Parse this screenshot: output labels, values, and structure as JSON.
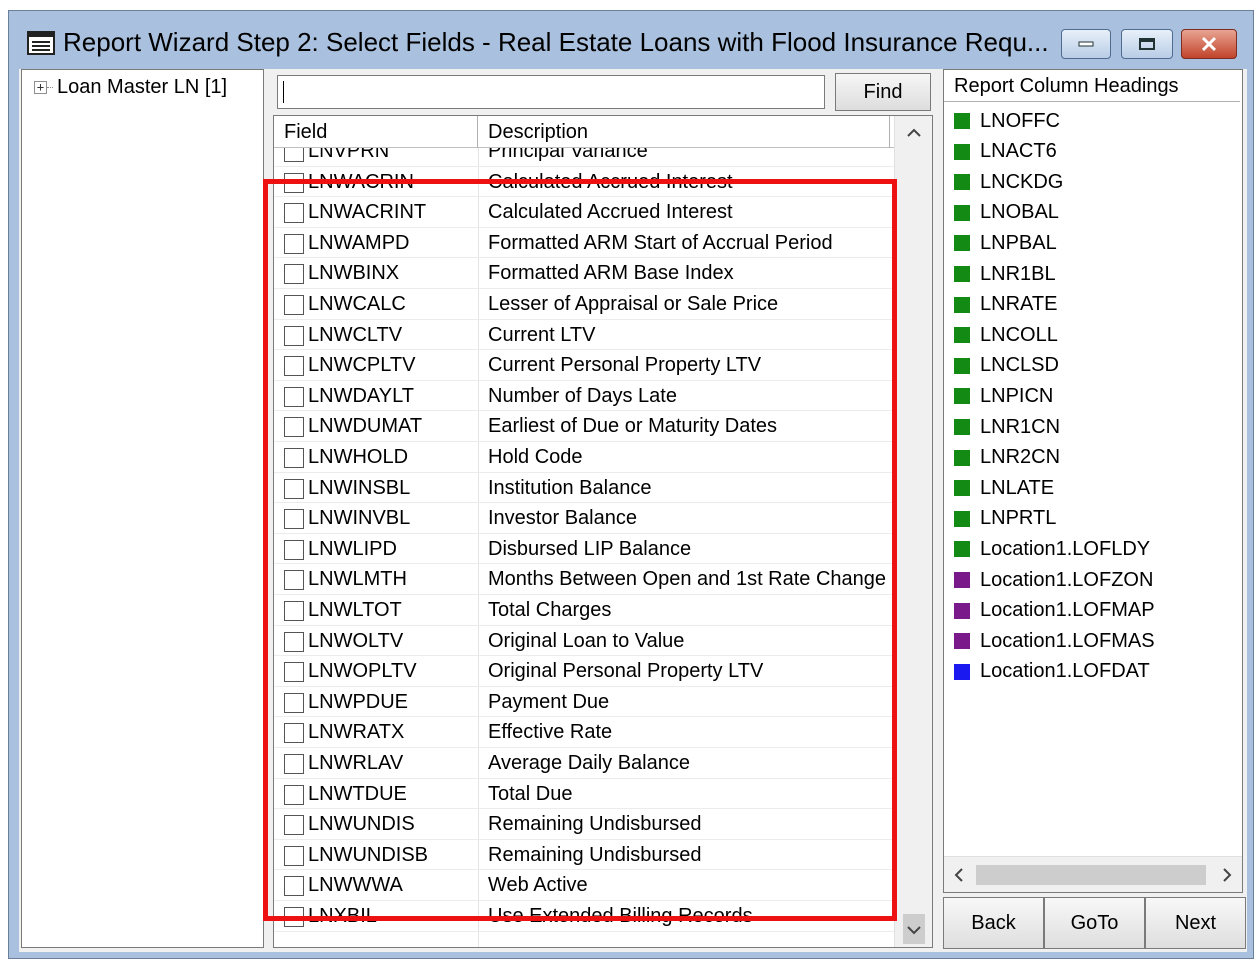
{
  "window": {
    "title": "Report Wizard Step 2:  Select Fields - Real Estate Loans with Flood Insurance Requ..."
  },
  "tree": {
    "expander": "+",
    "root_label": "Loan Master LN [1]"
  },
  "search": {
    "value": "",
    "find_label": "Find"
  },
  "grid": {
    "columns": [
      "Field",
      "Description"
    ],
    "rows": [
      {
        "field": "LNVPRN",
        "description": "Principal Variance"
      },
      {
        "field": "LNWACRIN",
        "description": "Calculated Accrued Interest"
      },
      {
        "field": "LNWACRINT",
        "description": "Calculated Accrued Interest"
      },
      {
        "field": "LNWAMPD",
        "description": "Formatted ARM Start of Accrual Period"
      },
      {
        "field": "LNWBINX",
        "description": "Formatted ARM Base Index"
      },
      {
        "field": "LNWCALC",
        "description": "Lesser of Appraisal or Sale Price"
      },
      {
        "field": "LNWCLTV",
        "description": "Current LTV"
      },
      {
        "field": "LNWCPLTV",
        "description": "Current Personal Property LTV"
      },
      {
        "field": "LNWDAYLT",
        "description": "Number of Days Late"
      },
      {
        "field": "LNWDUMAT",
        "description": "Earliest of Due or Maturity Dates"
      },
      {
        "field": "LNWHOLD",
        "description": "Hold Code"
      },
      {
        "field": "LNWINSBL",
        "description": "Institution Balance"
      },
      {
        "field": "LNWINVBL",
        "description": "Investor Balance"
      },
      {
        "field": "LNWLIPD",
        "description": "Disbursed LIP Balance"
      },
      {
        "field": "LNWLMTH",
        "description": "Months Between Open and 1st Rate Change"
      },
      {
        "field": "LNWLTOT",
        "description": "Total Charges"
      },
      {
        "field": "LNWOLTV",
        "description": "Original Loan to Value"
      },
      {
        "field": "LNWOPLTV",
        "description": "Original Personal Property LTV"
      },
      {
        "field": "LNWPDUE",
        "description": "Payment Due"
      },
      {
        "field": "LNWRATX",
        "description": "Effective Rate"
      },
      {
        "field": "LNWRLAV",
        "description": "Average Daily Balance"
      },
      {
        "field": "LNWTDUE",
        "description": "Total Due"
      },
      {
        "field": "LNWUNDIS",
        "description": "Remaining Undisbursed"
      },
      {
        "field": "LNWUNDISB",
        "description": "Remaining Undisbursed"
      },
      {
        "field": "LNWWWA",
        "description": "Web Active"
      },
      {
        "field": "LNXBIL",
        "description": "Use Extended Billing Records"
      }
    ],
    "scroll_up": "^",
    "scroll_down": "v"
  },
  "headings": {
    "title": "Report Column Headings",
    "items": [
      {
        "label": "LNOFFC",
        "color": "#138a13"
      },
      {
        "label": "LNACT6",
        "color": "#138a13"
      },
      {
        "label": "LNCKDG",
        "color": "#138a13"
      },
      {
        "label": "LNOBAL",
        "color": "#138a13"
      },
      {
        "label": "LNPBAL",
        "color": "#138a13"
      },
      {
        "label": "LNR1BL",
        "color": "#138a13"
      },
      {
        "label": "LNRATE",
        "color": "#138a13"
      },
      {
        "label": "LNCOLL",
        "color": "#138a13"
      },
      {
        "label": "LNCLSD",
        "color": "#138a13"
      },
      {
        "label": "LNPICN",
        "color": "#138a13"
      },
      {
        "label": "LNR1CN",
        "color": "#138a13"
      },
      {
        "label": "LNR2CN",
        "color": "#138a13"
      },
      {
        "label": "LNLATE",
        "color": "#138a13"
      },
      {
        "label": "LNPRTL",
        "color": "#138a13"
      },
      {
        "label": "Location1.LOFLDY",
        "color": "#138a13"
      },
      {
        "label": "Location1.LOFZON",
        "color": "#7a1a8a"
      },
      {
        "label": "Location1.LOFMAP",
        "color": "#7a1a8a"
      },
      {
        "label": "Location1.LOFMAS",
        "color": "#7a1a8a"
      },
      {
        "label": "Location1.LOFDAT",
        "color": "#1a1af0"
      }
    ],
    "scroll_left": "<",
    "scroll_right": ">"
  },
  "nav": {
    "back_label": "Back",
    "goto_label": "GoTo",
    "next_label": "Next"
  },
  "colors": {
    "highlight": "#ee1111",
    "titlebar": "#a9c1df"
  }
}
